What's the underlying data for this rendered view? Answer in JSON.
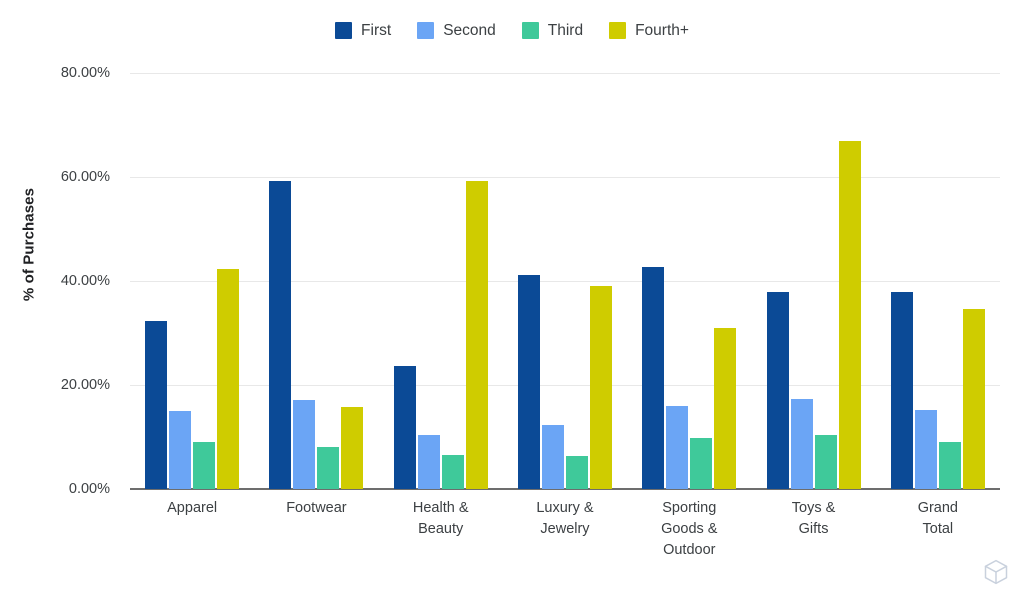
{
  "chart_data": {
    "type": "bar",
    "title": "",
    "xlabel": "",
    "ylabel": "% of Purchases",
    "ylim": [
      0,
      80
    ],
    "ytick_labels": [
      "0.00%",
      "20.00%",
      "40.00%",
      "60.00%",
      "80.00%"
    ],
    "ytick_values": [
      0,
      20,
      40,
      60,
      80
    ],
    "grid": true,
    "legend_position": "top-center",
    "categories": [
      "Apparel",
      "Footwear",
      "Health & Beauty",
      "Luxury & Jewelry",
      "Sporting Goods & Outdoor",
      "Toys & Gifts",
      "Grand Total"
    ],
    "category_lines": [
      [
        "Apparel"
      ],
      [
        "Footwear"
      ],
      [
        "Health &",
        "Beauty"
      ],
      [
        "Luxury &",
        "Jewelry"
      ],
      [
        "Sporting",
        "Goods &",
        "Outdoor"
      ],
      [
        "Toys &",
        "Gifts"
      ],
      [
        "Grand",
        "Total"
      ]
    ],
    "series": [
      {
        "name": "First",
        "color": "#0B4A96",
        "values": [
          32.3,
          59.3,
          23.6,
          41.2,
          42.7,
          37.8,
          37.8
        ]
      },
      {
        "name": "Second",
        "color": "#6BA5F5",
        "values": [
          15.0,
          17.2,
          10.4,
          12.4,
          16.0,
          17.3,
          15.2
        ]
      },
      {
        "name": "Third",
        "color": "#3FC99A",
        "values": [
          9.0,
          8.0,
          6.6,
          6.4,
          9.8,
          10.4,
          9.0
        ]
      },
      {
        "name": "Fourth+",
        "color": "#CFCC00",
        "values": [
          42.4,
          15.7,
          59.3,
          39.1,
          31.0,
          67.0,
          34.7
        ]
      }
    ]
  },
  "legend": {
    "items": [
      {
        "label": "First",
        "color": "#0B4A96"
      },
      {
        "label": "Second",
        "color": "#6BA5F5"
      },
      {
        "label": "Third",
        "color": "#3FC99A"
      },
      {
        "label": "Fourth+",
        "color": "#CFCC00"
      }
    ]
  },
  "axis": {
    "y_title": "% of Purchases"
  },
  "watermark": {
    "icon": "cube-logo-icon",
    "color": "#c9d1dd"
  }
}
